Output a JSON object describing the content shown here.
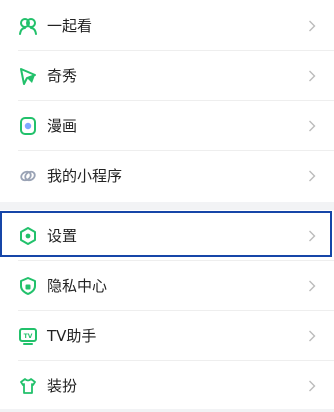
{
  "colors": {
    "accent_green": "#22c16b",
    "selection_border": "#1646a8",
    "text": "#222222",
    "chevron": "#bbbbbb"
  },
  "menu_top": [
    {
      "label": "一起看",
      "icon": "watch-together-icon"
    },
    {
      "label": "奇秀",
      "icon": "qixiu-icon"
    },
    {
      "label": "漫画",
      "icon": "comic-icon"
    },
    {
      "label": "我的小程序",
      "icon": "mini-program-icon"
    }
  ],
  "menu_bottom": [
    {
      "label": "设置",
      "icon": "settings-icon",
      "selected": true
    },
    {
      "label": "隐私中心",
      "icon": "privacy-shield-icon"
    },
    {
      "label": "TV助手",
      "icon": "tv-assistant-icon"
    },
    {
      "label": "装扮",
      "icon": "dress-up-icon"
    }
  ],
  "icon_text": {
    "tv": "TV"
  }
}
